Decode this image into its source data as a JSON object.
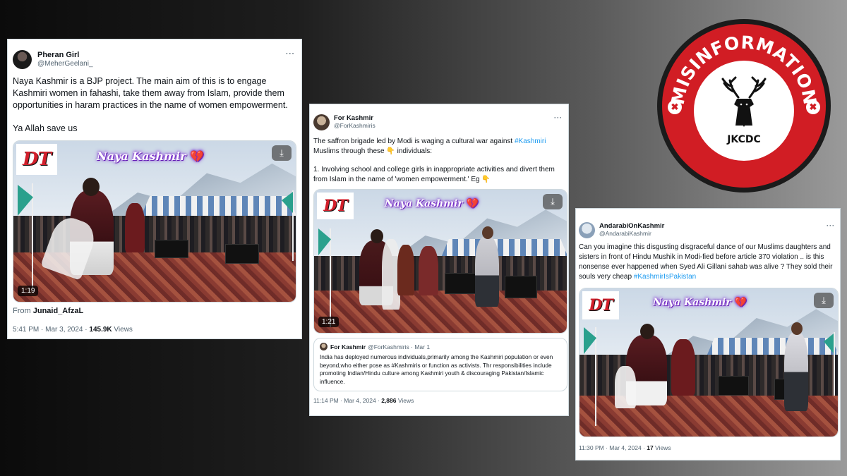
{
  "tweets": [
    {
      "display_name": "Pheran Girl",
      "handle": "@MeherGeelani_",
      "more": "···",
      "text_lines": [
        "Naya Kashmir is a BJP project. The main aim of this is to engage Kashmiri women in fahashi, take them away from Islam, provide them opportunities in haram practices in the name of women empowerment.",
        "Ya Allah save us"
      ],
      "video": {
        "logo": "DT",
        "overlay": "Naya Kashmir",
        "heart": "💔",
        "duration": "1:19",
        "download_icon": "download-icon"
      },
      "from_label": "From",
      "from_user": "Junaid_AfzaL",
      "time": "5:41 PM · Mar 3, 2024 · ",
      "views_count": "145.9K",
      "views_label": " Views"
    },
    {
      "display_name": "For Kashmir",
      "handle": "@ForKashmiris",
      "more": "···",
      "text_a": "The saffron brigade led by Modi is waging a cultural war against ",
      "hashtag": "#Kashmiri",
      "text_b": " Muslims through these 👇 individuals:",
      "text_c": "1. Involving school and college girls in inappropriate activities and divert them from Islam in the name of 'women empowerment.' Eg 👇",
      "video": {
        "logo": "DT",
        "overlay": "Naya Kashmir",
        "heart": "💔",
        "duration": "1:21",
        "download_icon": "download-icon"
      },
      "quote": {
        "name": "For Kashmir",
        "handle": "@ForKashmiris · Mar 1",
        "text": "India has deployed numerous individuals,primarily among the Kashmiri population or even beyond,who either pose as #Kashmiris or function as activists. Thr responsibilities include promoting Indian/Hindu culture among Kashmiri youth & discouraging Pakistan/Islamic influence."
      },
      "time": "11:14 PM · Mar 4, 2024 · ",
      "views_count": "2,886",
      "views_label": " Views"
    },
    {
      "display_name": "AndarabiOnKashmir",
      "handle": "@AndarabiKashmir",
      "more": "···",
      "text_a": "Can you imagine this disgusting disgraceful dance of our Muslims daughters and sisters in front of Hindu Mushik in Modi-fied before article 370 violation .. is this nonsense ever happened when Syed Ali Gillani sahab was alive ?  They sold their souls very cheap ",
      "hashtag": "#KashmirIsPakistan",
      "video": {
        "logo": "DT",
        "overlay": "Naya Kashmir",
        "heart": "💔",
        "download_icon": "download-icon"
      },
      "time": "11:30 PM · Mar 4, 2024 · ",
      "views_count": "17",
      "views_label": " Views"
    }
  ],
  "badge": {
    "title": "MISINFORMATION",
    "org": "JKCDC",
    "icon": "stag-icon",
    "colors": {
      "ring": "#d11d24",
      "outer": "#1b1b1b",
      "inner": "#ffffff"
    }
  },
  "colors": {
    "link": "#1d9bf0",
    "muted": "#536471",
    "text": "#0f1419"
  }
}
